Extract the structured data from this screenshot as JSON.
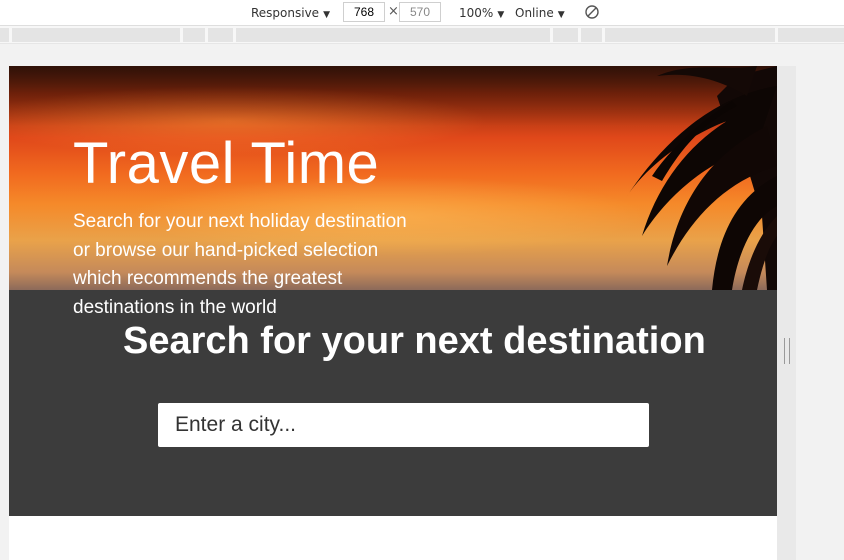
{
  "toolbar": {
    "device_label": "Responsive",
    "width_value": "768",
    "times_symbol": "×",
    "height_value": "570",
    "zoom_label": "100%",
    "network_label": "Online",
    "caret": "▼",
    "rotate_icon": "rotate-icon"
  },
  "hero": {
    "title": "Travel Time",
    "subtitle": "Search for your next holiday destination or browse our hand-picked selection which recommends the greatest destinations in the world"
  },
  "search": {
    "heading": "Search for your next destination",
    "placeholder": "Enter a city..."
  },
  "colors": {
    "search_section_bg": "#3c3c3c",
    "hero_accent": "#f16a1f"
  }
}
